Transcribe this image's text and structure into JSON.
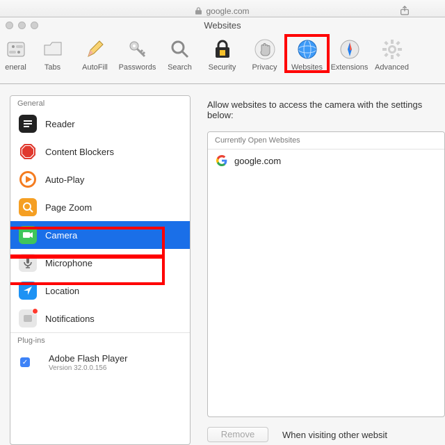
{
  "browser": {
    "address": "google.com"
  },
  "window": {
    "title": "Websites"
  },
  "toolbar": [
    {
      "id": "general",
      "label": "eneral"
    },
    {
      "id": "tabs",
      "label": "Tabs"
    },
    {
      "id": "autofill",
      "label": "AutoFill"
    },
    {
      "id": "passwords",
      "label": "Passwords"
    },
    {
      "id": "search",
      "label": "Search"
    },
    {
      "id": "security",
      "label": "Security"
    },
    {
      "id": "privacy",
      "label": "Privacy"
    },
    {
      "id": "websites",
      "label": "Websites",
      "selected": true
    },
    {
      "id": "extensions",
      "label": "Extensions"
    },
    {
      "id": "advanced",
      "label": "Advanced"
    }
  ],
  "sidebar": {
    "section_general": "General",
    "section_plugins": "Plug-ins",
    "items": [
      {
        "label": "Reader"
      },
      {
        "label": "Content Blockers"
      },
      {
        "label": "Auto-Play"
      },
      {
        "label": "Page Zoom"
      },
      {
        "label": "Camera",
        "selected": true
      },
      {
        "label": "Microphone"
      },
      {
        "label": "Location"
      },
      {
        "label": "Notifications"
      }
    ],
    "plugin": {
      "label": "Adobe Flash Player",
      "version": "Version 32.0.0.156",
      "enabled": true
    }
  },
  "right": {
    "header": "Allow websites to access the camera with the settings below:",
    "open_header": "Currently Open Websites",
    "sites": [
      {
        "host": "google.com"
      }
    ],
    "remove_label": "Remove",
    "footer": "When visiting other websit"
  },
  "colors": {
    "accent": "#1a6fe8",
    "callout": "#ff0000"
  }
}
